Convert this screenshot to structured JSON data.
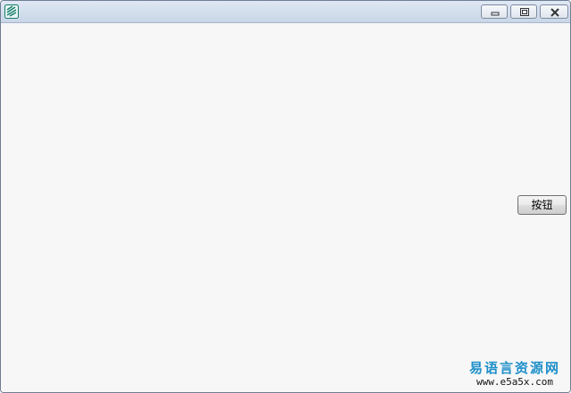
{
  "window": {
    "icon": "app-logo-icon",
    "caption_buttons": [
      "minimize-icon",
      "maximize-icon",
      "close-icon"
    ]
  },
  "client": {
    "button_label": "按钮"
  },
  "watermark": {
    "title": "易语言资源网",
    "url": "www.e5a5x.com"
  }
}
